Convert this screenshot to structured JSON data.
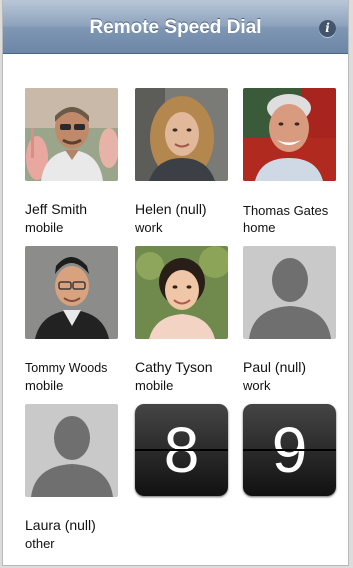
{
  "navbar": {
    "title": "Remote Speed Dial",
    "info_symbol": "i"
  },
  "contacts": [
    {
      "name": "Jeff Smith",
      "label": "mobile",
      "photo": "jeff-smith-photo"
    },
    {
      "name": "Helen (null)",
      "label": "work",
      "photo": "helen-photo"
    },
    {
      "name": "Thomas Gates",
      "label": "home",
      "photo": "thomas-gates-photo"
    },
    {
      "name": "Tommy Woods",
      "label": "mobile",
      "photo": "tommy-woods-photo"
    },
    {
      "name": "Cathy Tyson",
      "label": "mobile",
      "photo": "cathy-tyson-photo"
    },
    {
      "name": "Paul (null)",
      "label": "work",
      "photo": "silhouette-placeholder-icon"
    },
    {
      "name": "Laura (null)",
      "label": "other",
      "photo": "silhouette-placeholder-icon"
    }
  ],
  "empty_slots": [
    {
      "digit": "8"
    },
    {
      "digit": "9"
    }
  ],
  "colors": {
    "navbar_top": "#b9c7d8",
    "navbar_bottom": "#6d86a7",
    "placeholder_bg": "#c9c9c9",
    "placeholder_figure": "#6f6f6f",
    "dial_tile": "#1a1a1a"
  }
}
